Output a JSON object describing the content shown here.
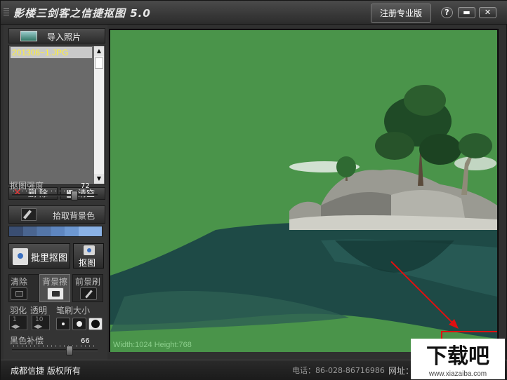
{
  "app": {
    "title": "影楼三剑客之信捷抠图 5.0",
    "register_button": "注册专业版",
    "help_label": "?",
    "minimize_label": "▬",
    "close_label": "✕"
  },
  "sidebar": {
    "import_button": "导入照片",
    "files": [
      "201306~1.JPG"
    ],
    "delete_button": "删 除",
    "clear_button": "清空",
    "strength": {
      "label": "抠图强度",
      "value": "72",
      "fraction": 0.72
    },
    "pick_bg_button": "拾取背景色",
    "palette": [
      "#3a4e72",
      "#4a6590",
      "#5476a8",
      "#5e86c0",
      "#6d98d2",
      "#8ab2e6"
    ],
    "batch_button": "批里抠图",
    "single_button": "抠图",
    "tools": [
      {
        "label": "清除",
        "active": false
      },
      {
        "label": "背景擦",
        "active": true
      },
      {
        "label": "前景刷",
        "active": false
      }
    ],
    "feather": {
      "label": "羽化",
      "value": "1"
    },
    "opacity": {
      "label": "透明",
      "value": "10"
    },
    "brush_size_label": "笔刷大小",
    "black_comp": {
      "label": "黑色补偿",
      "value": "66",
      "fraction": 0.66
    }
  },
  "canvas": {
    "background": "#4a944a",
    "dimensions_text": "Width:1024  Height:768"
  },
  "statusbar": {
    "copyright": "成都信捷  版权所有",
    "phone": "电话：86-028-86716986",
    "site_label": "网址："
  },
  "watermark": {
    "brand": "下载吧",
    "url": "www.xiazaiba.com"
  }
}
